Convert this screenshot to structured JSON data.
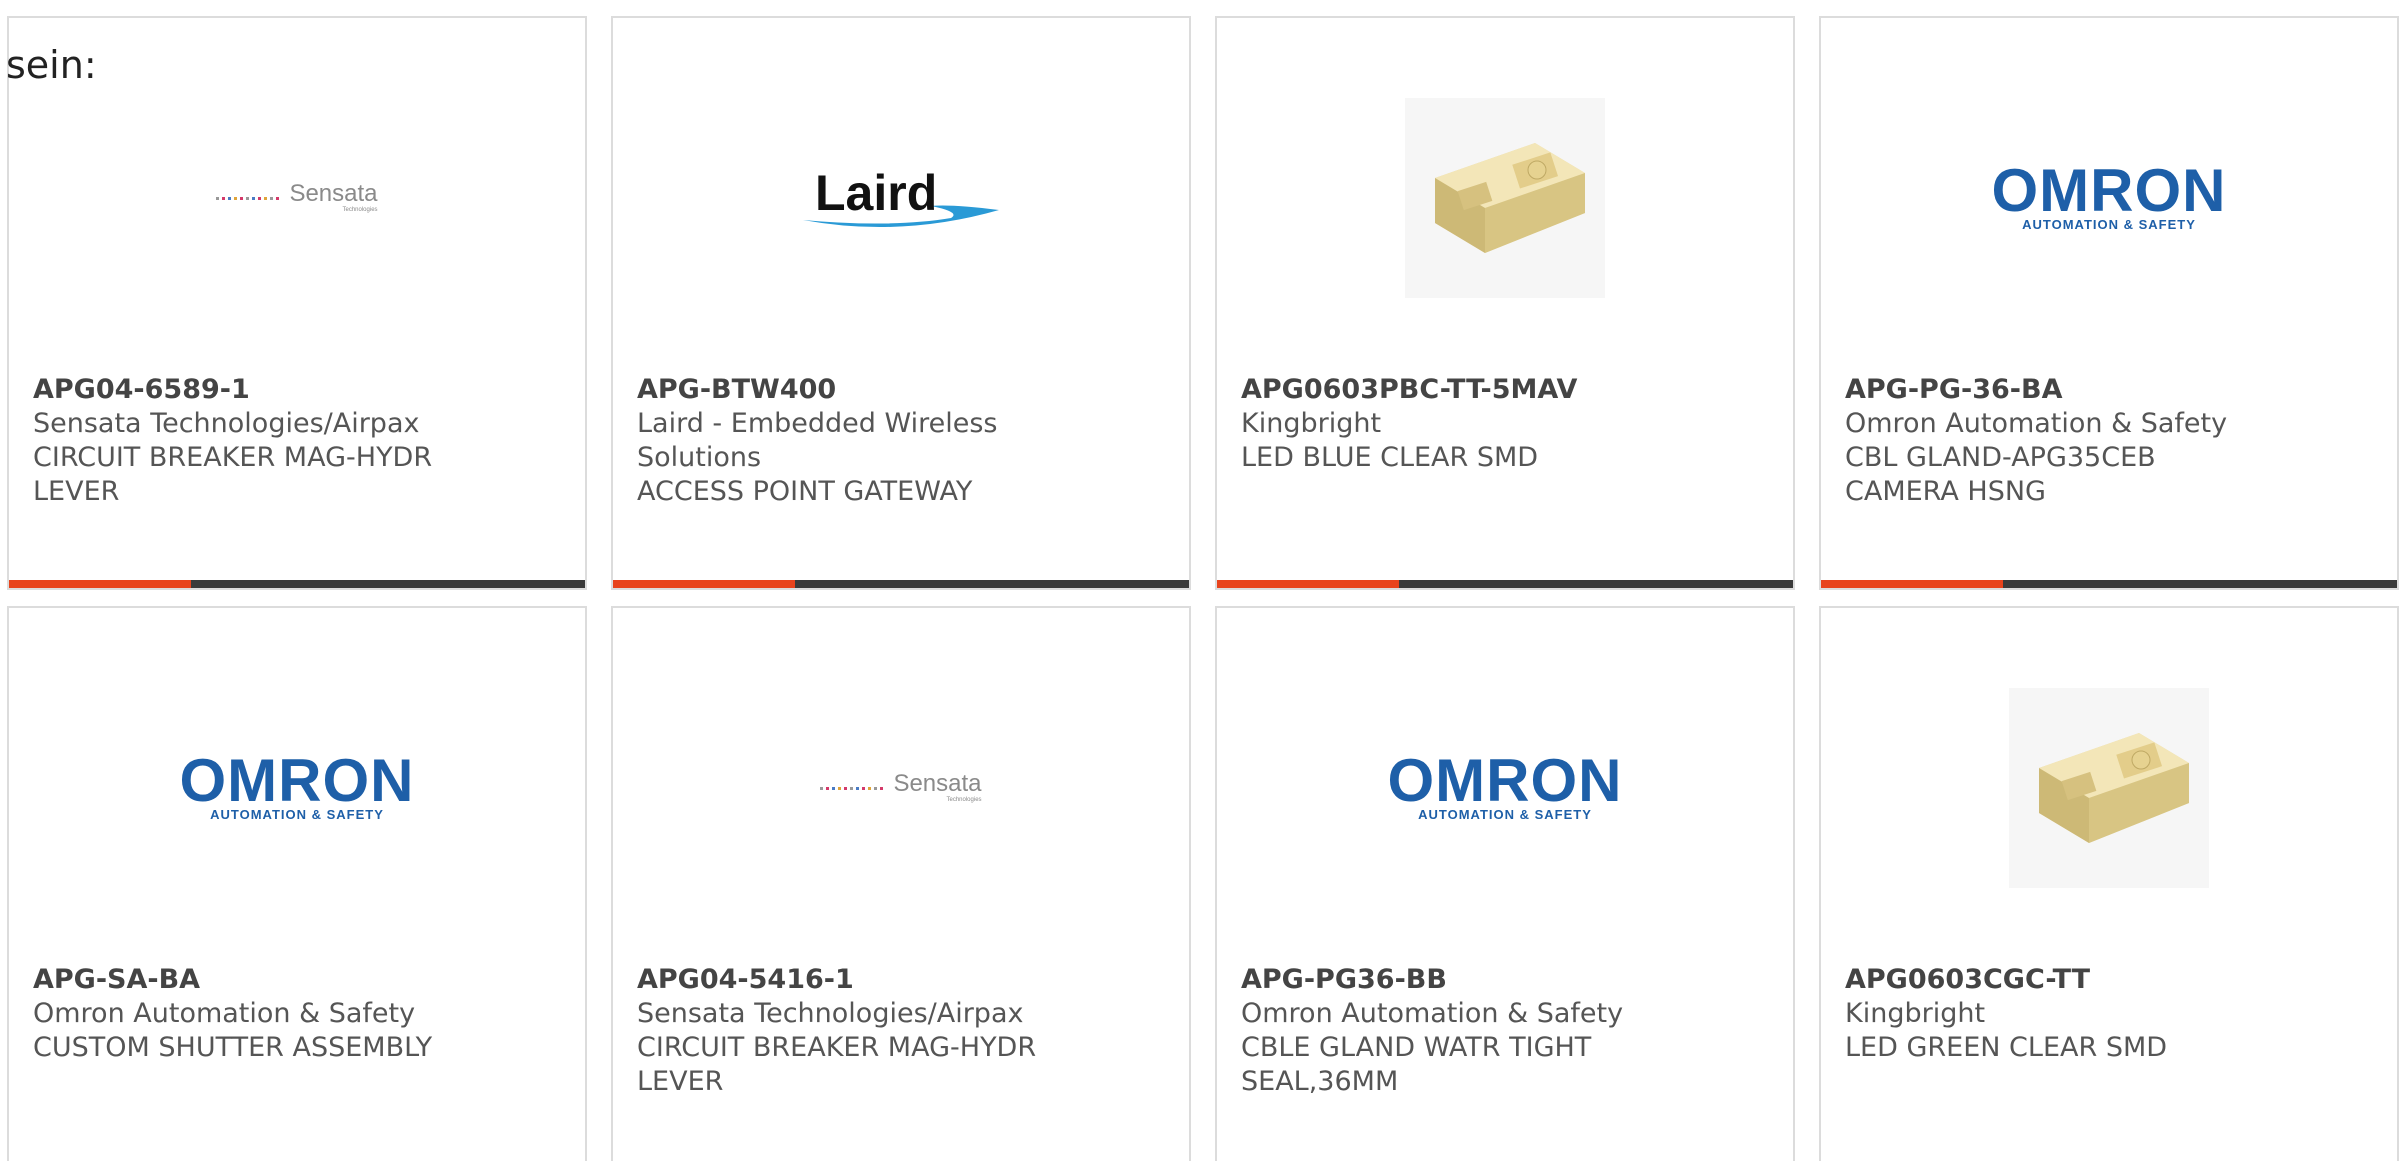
{
  "intro_text": "sein:",
  "products": [
    {
      "part_number": "APG04-6589-1",
      "manufacturer": "Sensata Technologies/Airpax",
      "description": "CIRCUIT BREAKER MAG-HYDR LEVER",
      "image": "sensata-logo",
      "image_text": "Sensata",
      "image_subtext": "Technologies"
    },
    {
      "part_number": "APG-BTW400",
      "manufacturer": "Laird - Embedded Wireless Solutions",
      "description": "ACCESS POINT GATEWAY",
      "image": "laird-logo",
      "image_text": "Laird"
    },
    {
      "part_number": "APG0603PBC-TT-5MAV",
      "manufacturer": "Kingbright",
      "description": "LED BLUE CLEAR SMD",
      "image": "led-chip-photo"
    },
    {
      "part_number": "APG-PG-36-BA",
      "manufacturer": "Omron Automation & Safety",
      "description": "CBL GLAND-APG35CEB CAMERA HSNG",
      "image": "omron-logo",
      "image_text": "OMRON",
      "image_subtext": "AUTOMATION & SAFETY"
    },
    {
      "part_number": "APG-SA-BA",
      "manufacturer": "Omron Automation & Safety",
      "description": "CUSTOM SHUTTER ASSEMBLY",
      "image": "omron-logo",
      "image_text": "OMRON",
      "image_subtext": "AUTOMATION & SAFETY"
    },
    {
      "part_number": "APG04-5416-1",
      "manufacturer": "Sensata Technologies/Airpax",
      "description": "CIRCUIT BREAKER MAG-HYDR LEVER",
      "image": "sensata-logo",
      "image_text": "Sensata",
      "image_subtext": "Technologies"
    },
    {
      "part_number": "APG-PG36-BB",
      "manufacturer": "Omron Automation & Safety",
      "description": "CBLE GLAND WATR TIGHT SEAL,36MM",
      "image": "omron-logo",
      "image_text": "OMRON",
      "image_subtext": "AUTOMATION & SAFETY"
    },
    {
      "part_number": "APG0603CGC-TT",
      "manufacturer": "Kingbright",
      "description": "LED GREEN CLEAR SMD",
      "image": "led-chip-photo"
    }
  ],
  "colors": {
    "accent": "#e8431c",
    "bar": "#3a3a3a",
    "omron_blue": "#1e5fa8",
    "laird_swoosh": "#2a9ad6"
  }
}
